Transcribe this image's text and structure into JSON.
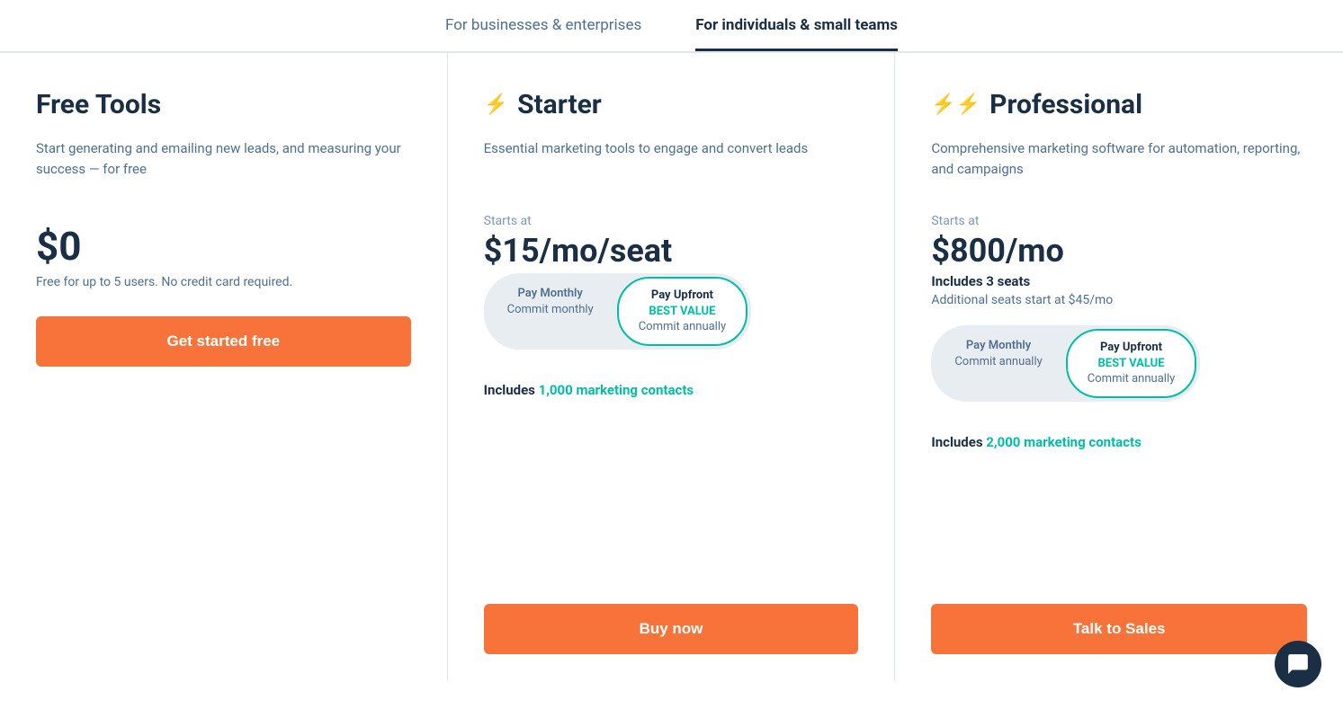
{
  "tabs": [
    {
      "id": "businesses",
      "label": "For businesses & enterprises",
      "active": false
    },
    {
      "id": "individuals",
      "label": "For individuals & small teams",
      "active": true
    }
  ],
  "plans": [
    {
      "id": "free",
      "name": "Free Tools",
      "icon": null,
      "icon_type": "none",
      "description": "Start generating and emailing new leads, and measuring your success — for free",
      "starts_at": null,
      "price": "$0",
      "price_unit": null,
      "price_note": "Free for up to 5 users. No credit card required.",
      "seats_included": null,
      "seats_additional": null,
      "toggle": null,
      "contacts": null,
      "cta_label": "Get started free"
    },
    {
      "id": "starter",
      "name": "Starter",
      "icon_type": "single-bolt",
      "description": "Essential marketing tools to engage and convert leads",
      "starts_at": "Starts at",
      "price": "$15/mo/seat",
      "price_note": null,
      "seats_included": null,
      "seats_additional": null,
      "toggle": {
        "option1": {
          "main": "Pay Monthly",
          "sub": "Commit monthly",
          "active": false
        },
        "option2": {
          "main": "Pay Upfront",
          "best_value": "BEST VALUE",
          "sub": "Commit annually",
          "active": true
        }
      },
      "contacts": "Includes 1,000 marketing contacts",
      "contacts_highlight": "marketing contacts",
      "contacts_number": "1,000",
      "cta_label": "Buy now"
    },
    {
      "id": "professional",
      "name": "Professional",
      "icon_type": "double-bolt",
      "description": "Comprehensive marketing software for automation, reporting, and campaigns",
      "starts_at": "Starts at",
      "price": "$800/mo",
      "price_note": null,
      "seats_included": "Includes 3 seats",
      "seats_additional": "Additional seats start at $45/mo",
      "toggle": {
        "option1": {
          "main": "Pay Monthly",
          "sub": "Commit annually",
          "active": false
        },
        "option2": {
          "main": "Pay Upfront",
          "best_value": "BEST VALUE",
          "sub": "Commit annually",
          "active": true
        }
      },
      "contacts": "Includes 2,000 marketing contacts",
      "contacts_highlight": "marketing contacts",
      "contacts_number": "2,000",
      "cta_label": "Talk to Sales"
    }
  ],
  "chat": {
    "label": "Chat"
  }
}
